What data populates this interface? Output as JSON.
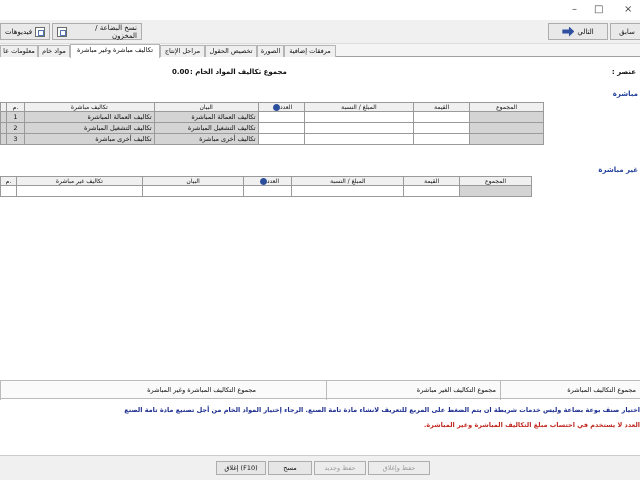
{
  "window": {
    "minimize": "–",
    "maximize": "□",
    "close": "×"
  },
  "toolbar": {
    "prev_label": "سابق",
    "next_label": "التالي",
    "copy_label": "نسخ البضاعة / المخزون",
    "videos_label": "فيديوهات"
  },
  "tabs": [
    "معلومات عا",
    "مواد خام",
    "تكاليف مباشرة وغير مباشرة",
    "مراحل الإنتاج",
    "تخصيص الحقول",
    "الصورة",
    "مرفقات إضافية"
  ],
  "content": {
    "item_label": "عنصر :",
    "raw_total_label": "مجموع تكاليف المواد الخام :",
    "raw_total_value": "0.00",
    "direct_title": "مباشرة",
    "indirect_title": "غير مباشرة"
  },
  "direct_table": {
    "headers": [
      "المجموع",
      "القيمة",
      "المبلغ / النسبة",
      "العدد",
      "البيان",
      "تكاليف مباشرة",
      "م."
    ],
    "rows": [
      {
        "statement": "تكاليف العمالة المباشرة",
        "name": "تكاليف العمالة المباشرة",
        "no": "1"
      },
      {
        "statement": "تكاليف التشغيل المباشرة",
        "name": "تكاليف التشغيل المباشرة",
        "no": "2"
      },
      {
        "statement": "تكاليف أخرى مباشرة",
        "name": "تكاليف أخرى مباشرة",
        "no": "3"
      }
    ]
  },
  "indirect_table": {
    "headers": [
      "المجموع",
      "القيمة",
      "المبلغ / النسبة",
      "العدد",
      "البيان",
      "تكاليف غير مباشرة",
      "م."
    ]
  },
  "totals": {
    "direct": "مجموع التكاليف المباشرة",
    "indirect": "مجموع التكاليف الغير مباشرة",
    "both": "مجموع التكاليف المباشرة وغير المباشرة"
  },
  "notes": {
    "line1": "اختيار صنف بوعة بضاعة وليس خدمات شريطة ان يتم الضغط على المربع للتعريف لانشاء مادة تامة الصنع. الرجاء إختيار المواد الخام من أجل تصنيع مادة تامة الصنع",
    "line2": "العدد لا يستخدم في احتساب مبلغ التكاليف المباشرة وغير المباشرة."
  },
  "bottom": {
    "save_close": "حفظ وإغلاق",
    "save_new": "حفظ وجديد",
    "clear": "مسح",
    "close": "إغلاق (F10)"
  },
  "colors": {
    "note_blue": "#1b2c8f",
    "note_red": "#c0271f",
    "section_blue": "#1f3f9a"
  }
}
